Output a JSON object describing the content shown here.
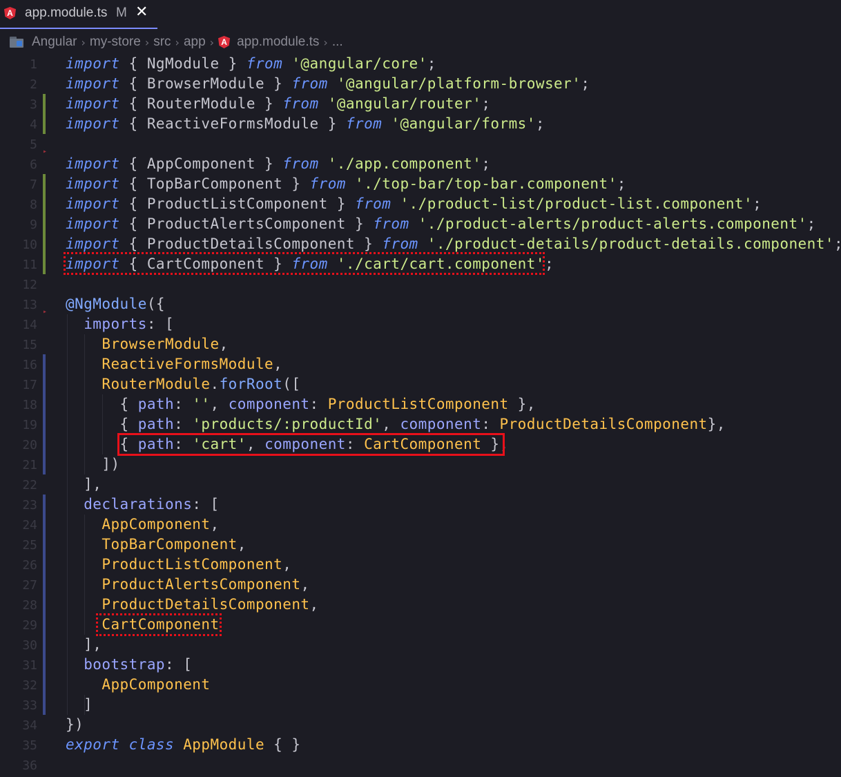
{
  "tab": {
    "filename": "app.module.ts",
    "status": "M",
    "close_glyph": "✕"
  },
  "breadcrumb": {
    "items": [
      "Angular",
      "my-store",
      "src",
      "app",
      "app.module.ts",
      "..."
    ]
  },
  "code_lines": [
    {
      "n": "1",
      "segs": [
        [
          "kw",
          "import"
        ],
        [
          "pl",
          " { "
        ],
        [
          "pl",
          "NgModule"
        ],
        [
          "pl",
          " } "
        ],
        [
          "kw",
          "from"
        ],
        [
          "pl",
          " "
        ],
        [
          "str",
          "'@angular/core'"
        ],
        [
          "pl",
          ";"
        ]
      ]
    },
    {
      "n": "2",
      "segs": [
        [
          "kw",
          "import"
        ],
        [
          "pl",
          " { "
        ],
        [
          "pl",
          "BrowserModule"
        ],
        [
          "pl",
          " } "
        ],
        [
          "kw",
          "from"
        ],
        [
          "pl",
          " "
        ],
        [
          "str",
          "'@angular/platform-browser'"
        ],
        [
          "pl",
          ";"
        ]
      ]
    },
    {
      "n": "3",
      "segs": [
        [
          "kw",
          "import"
        ],
        [
          "pl",
          " { "
        ],
        [
          "pl",
          "RouterModule"
        ],
        [
          "pl",
          " } "
        ],
        [
          "kw",
          "from"
        ],
        [
          "pl",
          " "
        ],
        [
          "str",
          "'@angular/router'"
        ],
        [
          "pl",
          ";"
        ]
      ]
    },
    {
      "n": "4",
      "segs": [
        [
          "kw",
          "import"
        ],
        [
          "pl",
          " { "
        ],
        [
          "pl",
          "ReactiveFormsModule"
        ],
        [
          "pl",
          " } "
        ],
        [
          "kw",
          "from"
        ],
        [
          "pl",
          " "
        ],
        [
          "str",
          "'@angular/forms'"
        ],
        [
          "pl",
          ";"
        ]
      ]
    },
    {
      "n": "5",
      "segs": []
    },
    {
      "n": "6",
      "segs": [
        [
          "kw",
          "import"
        ],
        [
          "pl",
          " { "
        ],
        [
          "pl",
          "AppComponent"
        ],
        [
          "pl",
          " } "
        ],
        [
          "kw",
          "from"
        ],
        [
          "pl",
          " "
        ],
        [
          "str",
          "'./app.component'"
        ],
        [
          "pl",
          ";"
        ]
      ]
    },
    {
      "n": "7",
      "segs": [
        [
          "kw",
          "import"
        ],
        [
          "pl",
          " { "
        ],
        [
          "pl",
          "TopBarComponent"
        ],
        [
          "pl",
          " } "
        ],
        [
          "kw",
          "from"
        ],
        [
          "pl",
          " "
        ],
        [
          "str",
          "'./top-bar/top-bar.component'"
        ],
        [
          "pl",
          ";"
        ]
      ]
    },
    {
      "n": "8",
      "segs": [
        [
          "kw",
          "import"
        ],
        [
          "pl",
          " { "
        ],
        [
          "pl",
          "ProductListComponent"
        ],
        [
          "pl",
          " } "
        ],
        [
          "kw",
          "from"
        ],
        [
          "pl",
          " "
        ],
        [
          "str",
          "'./product-list/product-list.component'"
        ],
        [
          "pl",
          ";"
        ]
      ]
    },
    {
      "n": "9",
      "segs": [
        [
          "kw",
          "import"
        ],
        [
          "pl",
          " { "
        ],
        [
          "pl",
          "ProductAlertsComponent"
        ],
        [
          "pl",
          " } "
        ],
        [
          "kw",
          "from"
        ],
        [
          "pl",
          " "
        ],
        [
          "str",
          "'./product-alerts/product-alerts.component'"
        ],
        [
          "pl",
          ";"
        ]
      ]
    },
    {
      "n": "10",
      "segs": [
        [
          "kw",
          "import"
        ],
        [
          "pl",
          " { "
        ],
        [
          "pl",
          "ProductDetailsComponent"
        ],
        [
          "pl",
          " } "
        ],
        [
          "kw",
          "from"
        ],
        [
          "pl",
          " "
        ],
        [
          "str",
          "'./product-details/product-details.component'"
        ],
        [
          "pl",
          ";"
        ]
      ]
    },
    {
      "n": "11",
      "segs": [
        [
          "kw",
          "import"
        ],
        [
          "pl",
          " { "
        ],
        [
          "pl",
          "CartComponent"
        ],
        [
          "pl",
          " } "
        ],
        [
          "kw",
          "from"
        ],
        [
          "pl",
          " "
        ],
        [
          "str",
          "'./cart/cart.component'"
        ],
        [
          "pl",
          ";"
        ]
      ]
    },
    {
      "n": "12",
      "segs": []
    },
    {
      "n": "13",
      "segs": [
        [
          "fn",
          "@NgModule"
        ],
        [
          "pl",
          "({"
        ]
      ]
    },
    {
      "n": "14",
      "segs": [
        [
          "pl",
          "  "
        ],
        [
          "prop",
          "imports"
        ],
        [
          "pl",
          ": ["
        ]
      ]
    },
    {
      "n": "15",
      "segs": [
        [
          "pl",
          "    "
        ],
        [
          "cls",
          "BrowserModule"
        ],
        [
          "pl",
          ","
        ]
      ]
    },
    {
      "n": "16",
      "segs": [
        [
          "pl",
          "    "
        ],
        [
          "cls",
          "ReactiveFormsModule"
        ],
        [
          "pl",
          ","
        ]
      ]
    },
    {
      "n": "17",
      "segs": [
        [
          "pl",
          "    "
        ],
        [
          "cls",
          "RouterModule"
        ],
        [
          "pl",
          "."
        ],
        [
          "fn",
          "forRoot"
        ],
        [
          "pl",
          "(["
        ]
      ]
    },
    {
      "n": "18",
      "segs": [
        [
          "pl",
          "      { "
        ],
        [
          "prop",
          "path"
        ],
        [
          "pl",
          ": "
        ],
        [
          "str",
          "''"
        ],
        [
          "pl",
          ", "
        ],
        [
          "prop",
          "component"
        ],
        [
          "pl",
          ": "
        ],
        [
          "cls",
          "ProductListComponent"
        ],
        [
          "pl",
          " },"
        ]
      ]
    },
    {
      "n": "19",
      "segs": [
        [
          "pl",
          "      { "
        ],
        [
          "prop",
          "path"
        ],
        [
          "pl",
          ": "
        ],
        [
          "str",
          "'products/:productId'"
        ],
        [
          "pl",
          ", "
        ],
        [
          "prop",
          "component"
        ],
        [
          "pl",
          ": "
        ],
        [
          "cls",
          "ProductDetailsComponent"
        ],
        [
          "pl",
          "},"
        ]
      ]
    },
    {
      "n": "20",
      "segs": [
        [
          "pl",
          "      { "
        ],
        [
          "prop",
          "path"
        ],
        [
          "pl",
          ": "
        ],
        [
          "str",
          "'cart'"
        ],
        [
          "pl",
          ", "
        ],
        [
          "prop",
          "component"
        ],
        [
          "pl",
          ": "
        ],
        [
          "cls",
          "CartComponent"
        ],
        [
          "pl",
          " },"
        ]
      ]
    },
    {
      "n": "21",
      "segs": [
        [
          "pl",
          "    ])"
        ]
      ]
    },
    {
      "n": "22",
      "segs": [
        [
          "pl",
          "  ],"
        ]
      ]
    },
    {
      "n": "23",
      "segs": [
        [
          "pl",
          "  "
        ],
        [
          "prop",
          "declarations"
        ],
        [
          "pl",
          ": ["
        ]
      ]
    },
    {
      "n": "24",
      "segs": [
        [
          "pl",
          "    "
        ],
        [
          "cls",
          "AppComponent"
        ],
        [
          "pl",
          ","
        ]
      ]
    },
    {
      "n": "25",
      "segs": [
        [
          "pl",
          "    "
        ],
        [
          "cls",
          "TopBarComponent"
        ],
        [
          "pl",
          ","
        ]
      ]
    },
    {
      "n": "26",
      "segs": [
        [
          "pl",
          "    "
        ],
        [
          "cls",
          "ProductListComponent"
        ],
        [
          "pl",
          ","
        ]
      ]
    },
    {
      "n": "27",
      "segs": [
        [
          "pl",
          "    "
        ],
        [
          "cls",
          "ProductAlertsComponent"
        ],
        [
          "pl",
          ","
        ]
      ]
    },
    {
      "n": "28",
      "segs": [
        [
          "pl",
          "    "
        ],
        [
          "cls",
          "ProductDetailsComponent"
        ],
        [
          "pl",
          ","
        ]
      ]
    },
    {
      "n": "29",
      "segs": [
        [
          "pl",
          "    "
        ],
        [
          "cls",
          "CartComponent"
        ]
      ]
    },
    {
      "n": "30",
      "segs": [
        [
          "pl",
          "  ],"
        ]
      ]
    },
    {
      "n": "31",
      "segs": [
        [
          "pl",
          "  "
        ],
        [
          "prop",
          "bootstrap"
        ],
        [
          "pl",
          ": ["
        ]
      ]
    },
    {
      "n": "32",
      "segs": [
        [
          "pl",
          "    "
        ],
        [
          "cls",
          "AppComponent"
        ]
      ]
    },
    {
      "n": "33",
      "segs": [
        [
          "pl",
          "  ]"
        ]
      ]
    },
    {
      "n": "34",
      "segs": [
        [
          "pl",
          "})"
        ]
      ]
    },
    {
      "n": "35",
      "segs": [
        [
          "kw",
          "export"
        ],
        [
          "pl",
          " "
        ],
        [
          "kw",
          "class"
        ],
        [
          "pl",
          " "
        ],
        [
          "cls",
          "AppModule"
        ],
        [
          "pl",
          " { }"
        ]
      ]
    },
    {
      "n": "36",
      "segs": []
    }
  ],
  "colors": {
    "background": "#1c1c24",
    "keyword": "#6c95ff",
    "string": "#cdeb8b",
    "class_name": "#ffc24d",
    "property": "#9aa6ff",
    "plain": "#c6c6cf",
    "line_number": "#3a3a44",
    "git_added_bar": "#6c8a3a",
    "git_modified_bar": "#3b4a8c",
    "highlight_red": "#e8101a",
    "tab_active_border": "#7c8cff"
  },
  "icons": {
    "tab_icon": "angular-icon",
    "breadcrumb_root_icon": "folder-icon",
    "breadcrumb_file_icon": "angular-icon",
    "close": "close-icon"
  }
}
